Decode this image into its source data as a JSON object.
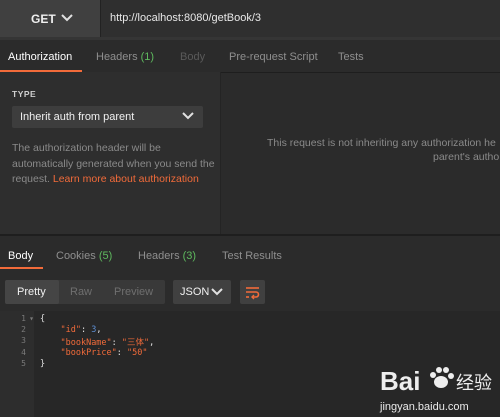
{
  "request": {
    "method": "GET",
    "url": "http://localhost:8080/getBook/3"
  },
  "request_tabs": [
    {
      "label": "Authorization",
      "count": ""
    },
    {
      "label": "Headers",
      "count": "(1)"
    },
    {
      "label": "Body",
      "count": ""
    },
    {
      "label": "Pre-request Script",
      "count": ""
    },
    {
      "label": "Tests",
      "count": ""
    }
  ],
  "auth": {
    "type_label": "TYPE",
    "selected": "Inherit auth from parent",
    "description": "The authorization header will be automatically generated when you send the request. ",
    "link": "Learn more about authorization",
    "right_message_line1": "This request is not inheriting any authorization he",
    "right_message_line2": "parent's autho"
  },
  "response_tabs": [
    {
      "label": "Body",
      "count": ""
    },
    {
      "label": "Cookies",
      "count": "(5)"
    },
    {
      "label": "Headers",
      "count": "(3)"
    },
    {
      "label": "Test Results",
      "count": ""
    }
  ],
  "view_modes": [
    "Pretty",
    "Raw",
    "Preview"
  ],
  "format": "JSON",
  "code_lines": [
    {
      "num": "1",
      "parts": [
        {
          "t": "{",
          "c": "p"
        }
      ]
    },
    {
      "num": "2",
      "parts": [
        {
          "t": "    ",
          "c": "p"
        },
        {
          "t": "\"id\"",
          "c": "k"
        },
        {
          "t": ": ",
          "c": "p"
        },
        {
          "t": "3",
          "c": "n"
        },
        {
          "t": ",",
          "c": "p"
        }
      ]
    },
    {
      "num": "3",
      "parts": [
        {
          "t": "    ",
          "c": "p"
        },
        {
          "t": "\"bookName\"",
          "c": "k"
        },
        {
          "t": ": ",
          "c": "p"
        },
        {
          "t": "\"三体\"",
          "c": "s"
        },
        {
          "t": ",",
          "c": "p"
        }
      ]
    },
    {
      "num": "4",
      "parts": [
        {
          "t": "    ",
          "c": "p"
        },
        {
          "t": "\"bookPrice\"",
          "c": "k"
        },
        {
          "t": ": ",
          "c": "p"
        },
        {
          "t": "\"50\"",
          "c": "s"
        }
      ]
    },
    {
      "num": "5",
      "parts": [
        {
          "t": "}",
          "c": "p"
        }
      ]
    }
  ],
  "watermark": {
    "brand": "Bai",
    "brand_tail": "经验",
    "url": "jingyan.baidu.com"
  },
  "colors": {
    "accent": "#f26b3a",
    "count_green": "#5eb95e",
    "number_blue": "#5e8fd4"
  }
}
